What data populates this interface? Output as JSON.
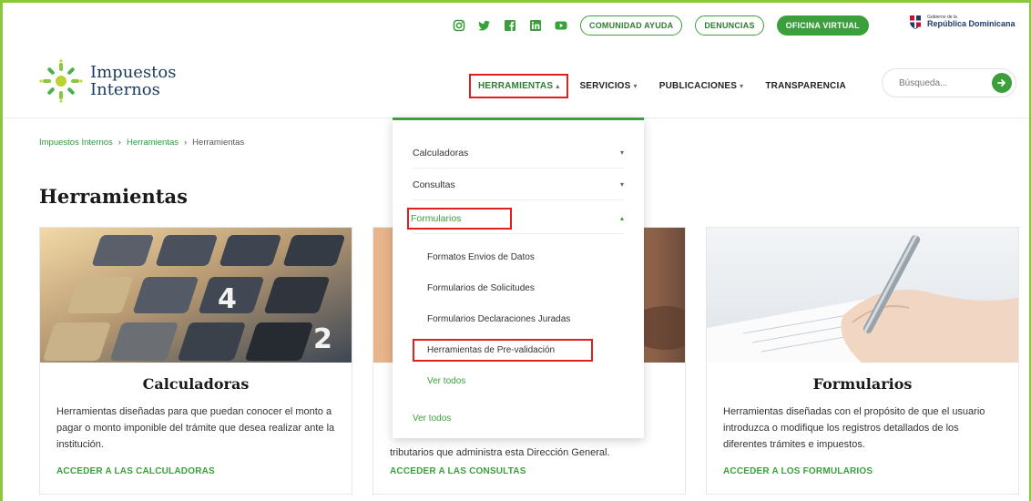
{
  "topbar": {
    "social_icons": [
      "instagram-icon",
      "twitter-icon",
      "facebook-icon",
      "linkedin-icon",
      "youtube-icon"
    ],
    "buttons": [
      "COMUNIDAD AYUDA",
      "DENUNCIAS",
      "OFICINA VIRTUAL"
    ],
    "gov_small": "Gobierno de la",
    "gov_big": "República Dominicana"
  },
  "logo": {
    "line1": "Impuestos",
    "line2": "Internos"
  },
  "nav": {
    "items": [
      "HERRAMIENTAS",
      "SERVICIOS",
      "PUBLICACIONES",
      "TRANSPARENCIA"
    ],
    "search_placeholder": "Búsqueda..."
  },
  "breadcrumb": [
    "Impuestos Internos",
    "Herramientas",
    "Herramientas"
  ],
  "page_title": "Herramientas",
  "dropdown": {
    "sections": [
      "Calculadoras",
      "Consultas",
      "Formularios"
    ],
    "sub_items": [
      "Formatos Envios de Datos",
      "Formularios de Solicitudes",
      "Formularios Declaraciones Juradas",
      "Herramientas de Pre-validación"
    ],
    "sub_more": "Ver todos",
    "more": "Ver todos"
  },
  "cards": [
    {
      "title": "Calculadoras",
      "description": "Herramientas diseñadas para que puedan conocer el monto a pagar o monto imponible del trámite que desea realizar ante la institución.",
      "link": "ACCEDER A LAS CALCULADORAS"
    },
    {
      "title": "",
      "description": "tributarios que administra esta Dirección General.",
      "link": "ACCEDER A LAS CONSULTAS"
    },
    {
      "title": "Formularios",
      "description": "Herramientas diseñadas con el propósito de que el usuario introduzca o modifique los registros detallados de los diferentes trámites e impuestos.",
      "link": "ACCEDER A LOS FORMULARIOS"
    }
  ],
  "colors": {
    "accent": "#3ba03b",
    "highlight": "#e02020",
    "navy": "#1a3a5c"
  }
}
